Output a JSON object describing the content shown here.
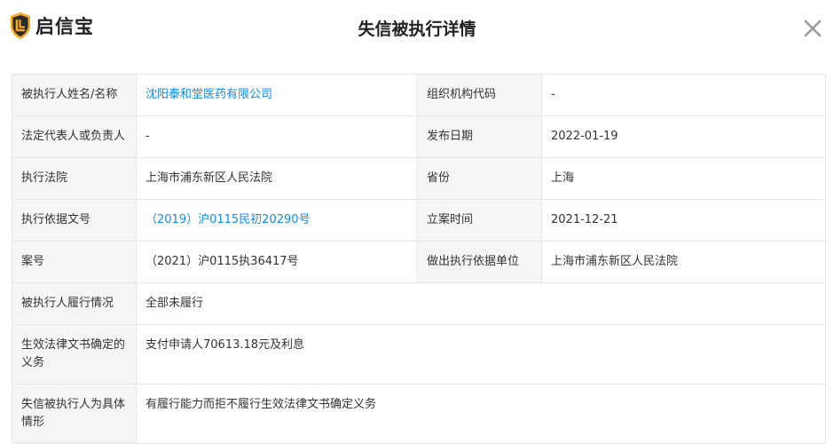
{
  "brand": {
    "name": "启信宝",
    "logo_icon": "shield-logo-icon",
    "color": "#f5a623"
  },
  "title": "失信被执行详情",
  "close_icon": "close-icon",
  "colors": {
    "link": "#128bed",
    "label_bg": "#f5f5f5",
    "border": "#e6e6e6"
  },
  "rows": [
    {
      "label1": "被执行人姓名/名称",
      "value1": "沈阳泰和堂医药有限公司",
      "label2": "组织机构代码",
      "value2": "-"
    },
    {
      "label1": "法定代表人或负责人",
      "value1": "-",
      "label2": "发布日期",
      "value2": "2022-01-19"
    },
    {
      "label1": "执行法院",
      "value1": "上海市浦东新区人民法院",
      "label2": "省份",
      "value2": "上海"
    },
    {
      "label1": "执行依据文号",
      "value1": "（2019）沪0115民初20290号",
      "label2": "立案时间",
      "value2": "2021-12-21"
    },
    {
      "label1": "案号",
      "value1": "（2021）沪0115执36417号",
      "label2": "做出执行依据单位",
      "value2": "上海市浦东新区人民法院"
    },
    {
      "label1": "被执行人履行情况",
      "value1": "全部未履行"
    },
    {
      "label1": "生效法律文书确定的义务",
      "value1": "支付申请人70613.18元及利息"
    },
    {
      "label1": "失信被执行人为具体情形",
      "value1": "有履行能力而拒不履行生效法律文书确定义务"
    }
  ]
}
